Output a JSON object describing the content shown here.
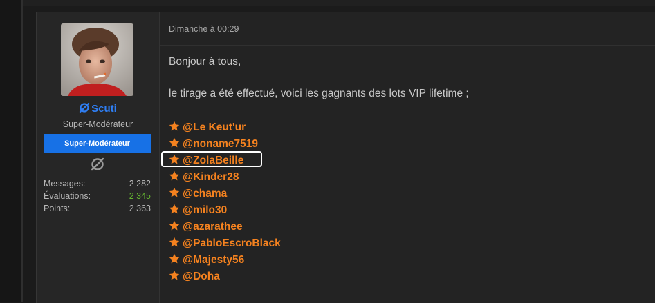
{
  "post": {
    "timestamp": "Dimanche à 00:29",
    "paragraphs": [
      "Bonjour à tous,",
      "le tirage a été effectué, voici les gagnants des lots VIP lifetime ;"
    ],
    "mentions": [
      "@Le Keut'ur",
      "@noname7519",
      "@ZolaBeille",
      "@Kinder28",
      "@chama",
      "@milo30",
      "@azarathee",
      "@PabloEscroBlack",
      "@Majesty56",
      "@Doha"
    ],
    "highlighted_mention": "@ZolaBeille"
  },
  "user": {
    "name": "Scuti",
    "title": "Super-Modérateur",
    "banner": "Super-Modérateur",
    "stats": [
      {
        "label": "Messages:",
        "value": "2 282"
      },
      {
        "label": "Évaluations:",
        "value": "2 345"
      },
      {
        "label": "Points:",
        "value": "2 363"
      }
    ]
  },
  "colors": {
    "username": "#2f7ff5",
    "banner": "#1771e6",
    "mention": "#f5821f",
    "positive": "#63b230",
    "background": "#232323"
  },
  "icons": {
    "username_icon": "scuti-ring-icon",
    "rank_icon": "scuti-ring-icon",
    "mention_icon": "star-icon"
  }
}
